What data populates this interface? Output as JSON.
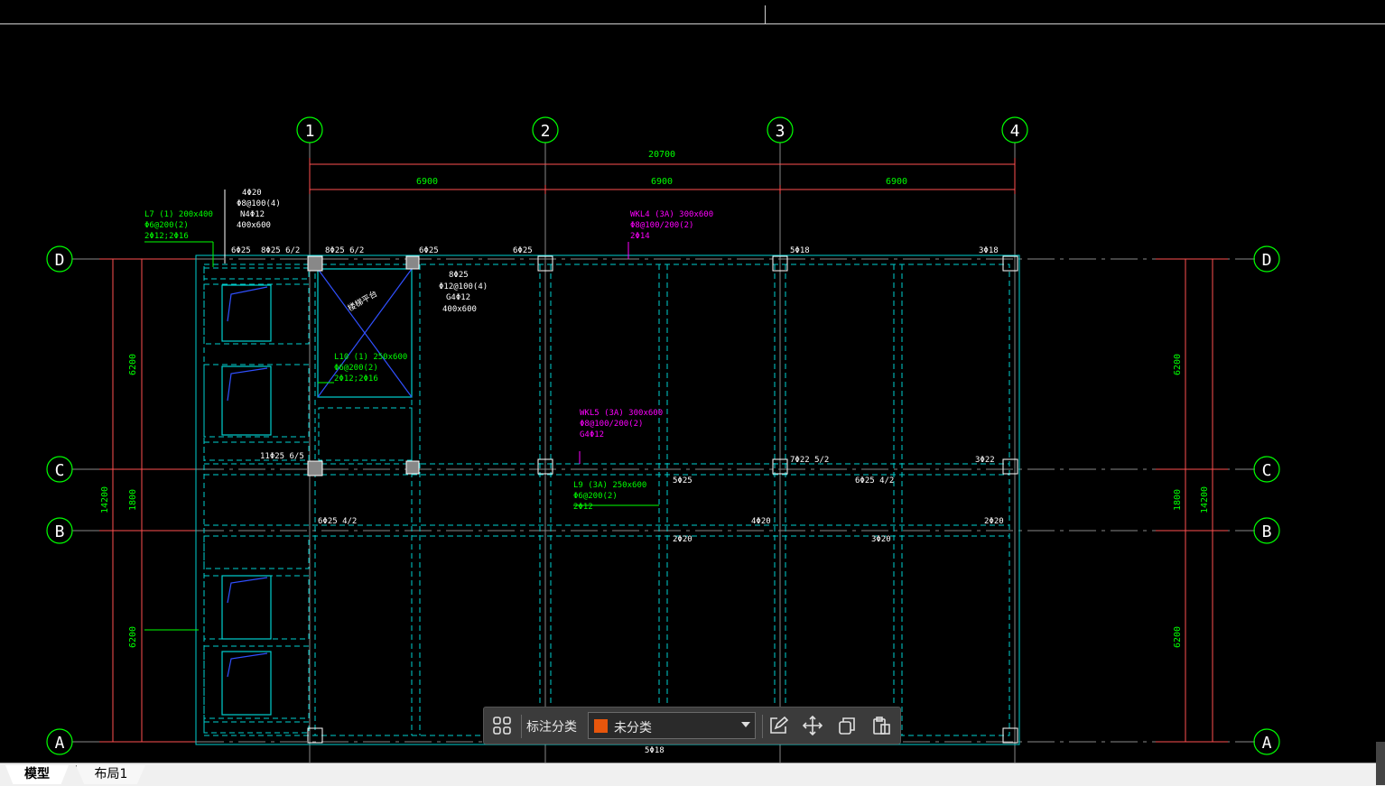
{
  "grid": {
    "columns": [
      "1",
      "2",
      "3",
      "4"
    ],
    "rows": [
      "D",
      "C",
      "B",
      "A"
    ]
  },
  "dimensions": {
    "overall": "20700",
    "spans": [
      "6900",
      "6900",
      "6900"
    ],
    "left_outer": "14200",
    "left_inner": [
      "6200",
      "1800",
      "6200"
    ],
    "right_outer": "14200",
    "right_inner": [
      "6200",
      "1800",
      "6200"
    ]
  },
  "annotations": {
    "magenta": [
      "WKL4 (3A) 300x600",
      "Φ8@100/200(2)",
      "2Φ14",
      "WKL5 (3A) 300x600",
      "Φ8@100/200(2)",
      "G4Φ12"
    ],
    "green": [
      "L7 (1) 200x400",
      "Φ6@200(2)",
      "2Φ12;2Φ16",
      "L10 (1) 250x600",
      "Φ6@200(2)",
      "2Φ12;2Φ16",
      "L9 (3A) 250x600",
      "Φ6@200(2)",
      "2Φ12"
    ],
    "white": [
      "4Φ20",
      "Φ8@100(4)",
      "N4Φ12",
      "400x600",
      "6Φ25",
      "8Φ25 6/2",
      "8Φ25 6/2",
      "6Φ25",
      "6Φ25",
      "5Φ18",
      "3Φ18",
      "8Φ25",
      "Φ12@100(4)",
      "G4Φ12",
      "400x600",
      "11Φ25 6/5",
      "7Φ22 5/2",
      "6Φ25 4/2",
      "6Φ25 4/2",
      "2Φ20",
      "4Φ20",
      "3Φ22",
      "5Φ25",
      "2Φ20",
      "3Φ20",
      "5Φ18"
    ],
    "stair_label": "楼梯平台"
  },
  "toolbar": {
    "label": "标注分类",
    "selected": "未分类",
    "swatch_color": "#e8560c",
    "buttons": [
      "grid-icon",
      "edit-icon",
      "move-icon",
      "copy-icon",
      "paste-icon"
    ]
  },
  "tabs": [
    "模型",
    "布局1"
  ],
  "colors": {
    "background": "#000000",
    "axis": "#00ff00",
    "beam": "#00d0d0",
    "dimension": "#ff5050",
    "text": "#ffffff",
    "magenta": "#ff00ff",
    "stair": "#3050ff"
  }
}
